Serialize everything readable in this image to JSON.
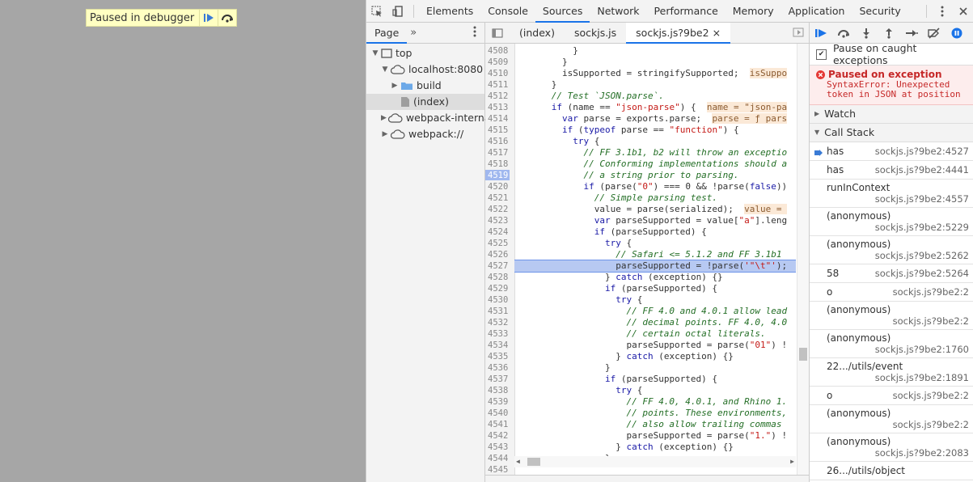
{
  "paused_banner": {
    "text": "Paused in debugger"
  },
  "devtools_tabs": [
    "Elements",
    "Console",
    "Sources",
    "Network",
    "Performance",
    "Memory",
    "Application",
    "Security"
  ],
  "active_tab": "Sources",
  "navigator": {
    "tab_label": "Page",
    "more": "»",
    "tree": [
      {
        "label": "top",
        "depth": 0,
        "expanded": true,
        "icon": "frame-icon"
      },
      {
        "label": "localhost:8080",
        "depth": 1,
        "expanded": true,
        "icon": "cloud-icon"
      },
      {
        "label": "build",
        "depth": 2,
        "expanded": false,
        "icon": "folder-icon"
      },
      {
        "label": "(index)",
        "depth": 2,
        "selected": true,
        "icon": "file-icon"
      },
      {
        "label": "webpack-internal:/",
        "depth": 1,
        "expanded": false,
        "icon": "cloud-icon"
      },
      {
        "label": "webpack://",
        "depth": 1,
        "expanded": false,
        "icon": "cloud-icon"
      }
    ]
  },
  "editor_tabs": [
    {
      "label": "(index)"
    },
    {
      "label": "sockjs.js"
    },
    {
      "label": "sockjs.js?9be2",
      "active": true,
      "close": "×"
    }
  ],
  "code_lines": [
    {
      "n": "4508",
      "html": "          }"
    },
    {
      "n": "4509",
      "html": "        }"
    },
    {
      "n": "4510",
      "html": "        isSupported = stringifySupported;  <span class='inl'>isSuppo</span>"
    },
    {
      "n": "4511",
      "html": "      }"
    },
    {
      "n": "4512",
      "html": "      <span class='cm'>// Test `JSON.parse`.</span>"
    },
    {
      "n": "4513",
      "html": "      <span class='kw'>if</span> (name == <span class='st'>\"json-parse\"</span>) {  <span class='inl'>name = \"json-pa</span>"
    },
    {
      "n": "4514",
      "html": "        <span class='kw'>var</span> parse = exports.parse;  <span class='inl'>parse = ƒ pars</span>"
    },
    {
      "n": "4515",
      "html": "        <span class='kw'>if</span> (<span class='kw'>typeof</span> parse == <span class='st'>\"function\"</span>) {"
    },
    {
      "n": "4516",
      "html": "          <span class='kw'>try</span> {"
    },
    {
      "n": "4517",
      "html": "            <span class='cm'>// FF 3.1b1, b2 will throw an exceptio</span>"
    },
    {
      "n": "4518",
      "html": "            <span class='cm'>// Conforming implementations should a</span>"
    },
    {
      "n": "4519",
      "html": "            <span class='cm'>// a string prior to parsing.</span>",
      "breakpoint": true
    },
    {
      "n": "4520",
      "html": "            <span class='kw'>if</span> (parse(<span class='st'>\"0\"</span>) === 0 && !parse(<span class='kw'>false</span>))"
    },
    {
      "n": "4521",
      "html": "              <span class='cm'>// Simple parsing test.</span>"
    },
    {
      "n": "4522",
      "html": "              value = parse(serialized);  <span class='inl'>value = </span>"
    },
    {
      "n": "4523",
      "html": "              <span class='kw'>var</span> parseSupported = value[<span class='st'>\"a\"</span>].leng"
    },
    {
      "n": "4524",
      "html": "              <span class='kw'>if</span> (parseSupported) {"
    },
    {
      "n": "4525",
      "html": "                <span class='kw'>try</span> {"
    },
    {
      "n": "4526",
      "html": "                  <span class='cm'>// Safari <= 5.1.2 and FF 3.1b1</span>"
    },
    {
      "n": "4527",
      "html": "                  parseSupported = !parse(<span class='st'>'\"\\t\"'</span>);",
      "current": true
    },
    {
      "n": "4528",
      "html": "                } <span class='kw'>catch</span> (exception) {}"
    },
    {
      "n": "4529",
      "html": "                <span class='kw'>if</span> (parseSupported) {"
    },
    {
      "n": "4530",
      "html": "                  <span class='kw'>try</span> {"
    },
    {
      "n": "4531",
      "html": "                    <span class='cm'>// FF 4.0 and 4.0.1 allow lead</span>"
    },
    {
      "n": "4532",
      "html": "                    <span class='cm'>// decimal points. FF 4.0, 4.0</span>"
    },
    {
      "n": "4533",
      "html": "                    <span class='cm'>// certain octal literals.</span>"
    },
    {
      "n": "4534",
      "html": "                    parseSupported = parse(<span class='st'>\"01\"</span>) !"
    },
    {
      "n": "4535",
      "html": "                  } <span class='kw'>catch</span> (exception) {}"
    },
    {
      "n": "4536",
      "html": "                }"
    },
    {
      "n": "4537",
      "html": "                <span class='kw'>if</span> (parseSupported) {"
    },
    {
      "n": "4538",
      "html": "                  <span class='kw'>try</span> {"
    },
    {
      "n": "4539",
      "html": "                    <span class='cm'>// FF 4.0, 4.0.1, and Rhino 1.</span>"
    },
    {
      "n": "4540",
      "html": "                    <span class='cm'>// points. These environments,</span>"
    },
    {
      "n": "4541",
      "html": "                    <span class='cm'>// also allow trailing commas</span>"
    },
    {
      "n": "4542",
      "html": "                    parseSupported = parse(<span class='st'>\"1.\"</span>) !"
    },
    {
      "n": "4543",
      "html": "                  } <span class='kw'>catch</span> (exception) {}"
    },
    {
      "n": "4544",
      "html": "                }"
    },
    {
      "n": "4545",
      "html": ""
    }
  ],
  "debugger": {
    "pause_on_caught": {
      "label": "Pause on caught exceptions",
      "checked": true
    },
    "exception": {
      "title": "Paused on exception",
      "message": "SyntaxError: Unexpected token in JSON at position"
    },
    "watch_label": "Watch",
    "callstack_label": "Call Stack",
    "frames": [
      {
        "fn": "has",
        "loc": "sockjs.js?9be2:4527",
        "current": true,
        "layout": "single"
      },
      {
        "fn": "has",
        "loc": "sockjs.js?9be2:4441",
        "layout": "single"
      },
      {
        "fn": "runInContext",
        "loc": "sockjs.js?9be2:4557",
        "layout": "double"
      },
      {
        "fn": "(anonymous)",
        "loc": "sockjs.js?9be2:5229",
        "layout": "double"
      },
      {
        "fn": "(anonymous)",
        "loc": "sockjs.js?9be2:5262",
        "layout": "double"
      },
      {
        "fn": "58",
        "loc": "sockjs.js?9be2:5264",
        "layout": "single"
      },
      {
        "fn": "o",
        "loc": "sockjs.js?9be2:2",
        "layout": "single"
      },
      {
        "fn": "(anonymous)",
        "loc": "sockjs.js?9be2:2",
        "layout": "double"
      },
      {
        "fn": "(anonymous)",
        "loc": "sockjs.js?9be2:1760",
        "layout": "double"
      },
      {
        "fn": "22.../utils/event",
        "loc": "sockjs.js?9be2:1891",
        "layout": "double"
      },
      {
        "fn": "o",
        "loc": "sockjs.js?9be2:2",
        "layout": "single"
      },
      {
        "fn": "(anonymous)",
        "loc": "sockjs.js?9be2:2",
        "layout": "double"
      },
      {
        "fn": "(anonymous)",
        "loc": "sockjs.js?9be2:2083",
        "layout": "double"
      },
      {
        "fn": "26.../utils/object",
        "loc": "",
        "layout": "single"
      }
    ]
  },
  "colors": {
    "accent": "#1a73e8",
    "error": "#c62828",
    "current_line": "#b7c9f2"
  }
}
